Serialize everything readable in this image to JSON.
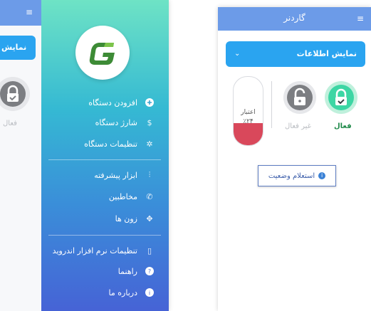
{
  "left_screen": {
    "background": {
      "dropdown_label": "نمایش",
      "status_label": "فعال"
    },
    "drawer": {
      "logo_letter": "G",
      "items_group1": [
        {
          "label": "افزودن دستگاه",
          "icon": "plus-circle-icon"
        },
        {
          "label": "شارژ دستگاه",
          "icon": "dollar-icon"
        },
        {
          "label": "تنظیمات دستگاه",
          "icon": "gear-icon"
        }
      ],
      "items_group2": [
        {
          "label": "ابزار پیشرفته",
          "icon": "sliders-icon"
        },
        {
          "label": "مخاطبین",
          "icon": "phone-icon"
        },
        {
          "label": "زون ها",
          "icon": "move-icon"
        }
      ],
      "items_group3": [
        {
          "label": "تنظیمات نرم افزار اندروید",
          "icon": "mobile-icon"
        },
        {
          "label": "راهنما",
          "icon": "help-icon"
        },
        {
          "label": "درباره ما",
          "icon": "info-icon"
        }
      ]
    }
  },
  "right_screen": {
    "title": "گاردنر",
    "dropdown_label": "نمایش اطلاعات",
    "status": {
      "active_label": "فعال",
      "inactive_label": "غیر فعال"
    },
    "credit": {
      "label": "اعتبار",
      "value": "٪۲۴",
      "fill_fraction": 0.24
    },
    "inquiry_button": "استعلام وضعیت"
  },
  "colors": {
    "topbar": "#6c9be8",
    "dropdown": "#2aa4f0",
    "active_green": "#3dd6a4",
    "inactive_gray": "#7c7e82",
    "credit_red": "#d9485b"
  }
}
